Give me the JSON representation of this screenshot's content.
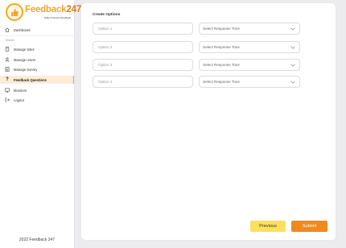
{
  "brand": {
    "name_main": "Feedback",
    "name_accent": "247",
    "tagline": "Daily Focused Feedback",
    "main_color": "#f5a623",
    "accent_color": "#f08a1c"
  },
  "sidebar": {
    "dashboard": {
      "label": "Dashboard",
      "icon": "home-icon"
    },
    "section_label": "Master",
    "items": [
      {
        "label": "Manage Sites",
        "icon": "building-icon",
        "active": false
      },
      {
        "label": "Manage Users",
        "icon": "user-icon",
        "active": false
      },
      {
        "label": "Manage Survey",
        "icon": "survey-icon",
        "active": false
      },
      {
        "label": "Feedback Questions",
        "icon": "question-icon",
        "active": true
      },
      {
        "label": "Monitors",
        "icon": "monitor-icon",
        "active": false
      },
      {
        "label": "Logout",
        "icon": "logout-icon",
        "active": false
      }
    ],
    "copyright": "2022 Feedback 247"
  },
  "main": {
    "title": "Create Options",
    "options": [
      {
        "placeholder": "Option 1",
        "select_value": "Select Response Tone"
      },
      {
        "placeholder": "Option 2",
        "select_value": "Select Response Tone"
      },
      {
        "placeholder": "Option 3",
        "select_value": "Select Response Tone"
      },
      {
        "placeholder": "Option 4",
        "select_value": "Select Response Tone"
      }
    ],
    "previous_label": "Previous",
    "submit_label": "Submit"
  }
}
